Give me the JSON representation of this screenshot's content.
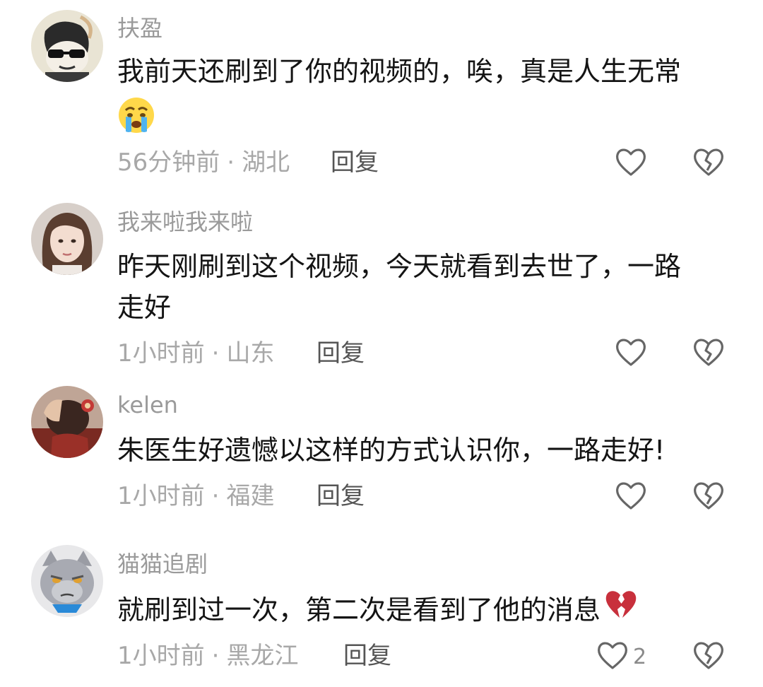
{
  "comments": [
    {
      "username": "扶盈",
      "content": "我前天还刷到了你的视频的，唉，真是人生无常",
      "emoji": "crying-face",
      "time": "56分钟前",
      "location": "湖北",
      "reply": "回复",
      "avatar": "avatar-cartoon-sunglasses"
    },
    {
      "username": "我来啦我来啦",
      "content_line1": "昨天刚刷到这个视频，今天就看到去世了，一路",
      "content_line2": "走好",
      "time": "1小时前",
      "location": "山东",
      "reply": "回复",
      "avatar": "avatar-woman-portrait"
    },
    {
      "username": "kelen",
      "content": "朱医生好遗憾以这样的方式认识你，一路走好!",
      "time": "1小时前",
      "location": "福建",
      "reply": "回复",
      "avatar": "avatar-person-hair"
    },
    {
      "username": "猫猫追剧",
      "content": "就刷到过一次，第二次是看到了他的消息",
      "emoji": "broken-heart",
      "time": "1小时前",
      "location": "黑龙江",
      "reply": "回复",
      "like_count": "2",
      "avatar": "avatar-grumpy-cat"
    }
  ],
  "separator": "·",
  "colors": {
    "username": "#9a9a9a",
    "content": "#141414",
    "meta": "#a8a8a8",
    "icon": "#666666",
    "broken_heart": "#c8303c"
  }
}
